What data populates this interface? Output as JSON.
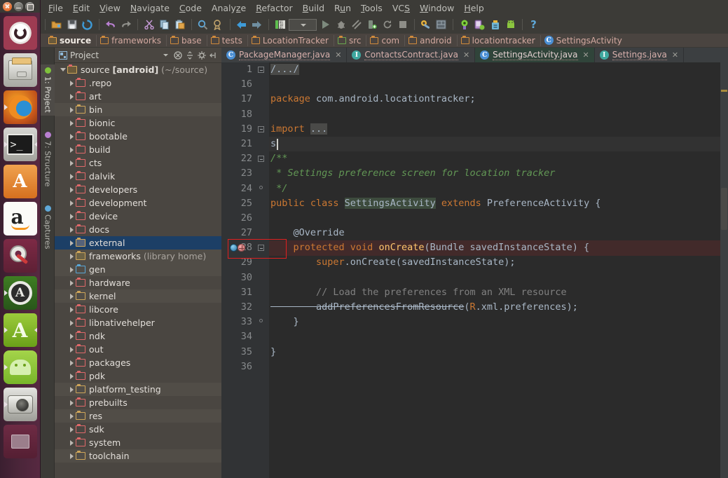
{
  "window_buttons": [
    {
      "name": "close",
      "icon": "close-icon"
    },
    {
      "name": "minimize",
      "icon": "minimize-icon"
    },
    {
      "name": "maximize",
      "icon": "maximize-icon"
    }
  ],
  "launcher": {
    "items": [
      {
        "label": "Ubuntu Dash",
        "icon": "ubuntu-dash-icon",
        "running": false
      },
      {
        "label": "Files",
        "icon": "files-icon",
        "running": false
      },
      {
        "label": "Firefox Web Browser",
        "icon": "firefox-icon",
        "running": true
      },
      {
        "label": "Terminal",
        "icon": "terminal-icon",
        "running": true
      },
      {
        "label": "Ubuntu Software Center",
        "icon": "software-center-icon",
        "running": false
      },
      {
        "label": "Amazon",
        "icon": "amazon-icon",
        "running": false
      },
      {
        "label": "System Settings",
        "icon": "system-settings-icon",
        "running": false
      },
      {
        "label": "Android Studio",
        "icon": "android-studio-icon",
        "running": true
      },
      {
        "label": "Android Virtual Device Manager",
        "icon": "avd-manager-icon",
        "running": true
      },
      {
        "label": "Android SDK Manager",
        "icon": "android-robot-icon",
        "running": true
      },
      {
        "label": "Camera",
        "icon": "camera-icon",
        "running": true
      },
      {
        "label": "Trash",
        "icon": "trash-icon",
        "running": false
      }
    ]
  },
  "menubar": {
    "items": [
      {
        "label": "File",
        "mnemonic": "F"
      },
      {
        "label": "Edit",
        "mnemonic": "E"
      },
      {
        "label": "View",
        "mnemonic": "V"
      },
      {
        "label": "Navigate",
        "mnemonic": "N"
      },
      {
        "label": "Code",
        "mnemonic": "C"
      },
      {
        "label": "Analyze",
        "mnemonic": "z"
      },
      {
        "label": "Refactor",
        "mnemonic": "R"
      },
      {
        "label": "Build",
        "mnemonic": "B"
      },
      {
        "label": "Run",
        "mnemonic": "u"
      },
      {
        "label": "Tools",
        "mnemonic": "T"
      },
      {
        "label": "VCS",
        "mnemonic": "S"
      },
      {
        "label": "Window",
        "mnemonic": "W"
      },
      {
        "label": "Help",
        "mnemonic": "H"
      }
    ]
  },
  "toolbar": {
    "buttons": [
      {
        "name": "open-project-icon",
        "title": "Open"
      },
      {
        "name": "save-all-icon",
        "title": "Save All"
      },
      {
        "name": "sync-icon",
        "title": "Synchronize"
      },
      {
        "sep": true
      },
      {
        "name": "undo-icon",
        "title": "Undo"
      },
      {
        "name": "redo-icon",
        "title": "Redo"
      },
      {
        "sep": true
      },
      {
        "name": "cut-icon",
        "title": "Cut"
      },
      {
        "name": "copy-icon",
        "title": "Copy"
      },
      {
        "name": "paste-icon",
        "title": "Paste"
      },
      {
        "sep": true
      },
      {
        "name": "find-icon",
        "title": "Find"
      },
      {
        "name": "replace-icon",
        "title": "Replace"
      },
      {
        "sep": true
      },
      {
        "name": "back-icon",
        "title": "Back"
      },
      {
        "name": "forward-icon",
        "title": "Forward"
      },
      {
        "sep": true
      },
      {
        "name": "run-config-icon",
        "title": "Run Configurations"
      },
      {
        "name": "run-config-dropdown",
        "title": "Select Run Configuration"
      },
      {
        "name": "run-icon",
        "title": "Run"
      },
      {
        "name": "debug-icon",
        "title": "Debug"
      },
      {
        "name": "coverage-icon",
        "title": "Run with Coverage"
      },
      {
        "name": "attach-debugger-icon",
        "title": "Attach debugger"
      },
      {
        "name": "rerun-icon",
        "title": "Rerun"
      },
      {
        "name": "stop-icon",
        "title": "Stop"
      },
      {
        "sep": true
      },
      {
        "name": "sdk-manager-icon",
        "title": "SDK Manager"
      },
      {
        "name": "avd-manager-icon",
        "title": "AVD Manager"
      },
      {
        "sep": true
      },
      {
        "name": "monitor-icon",
        "title": "Android Device Monitor"
      },
      {
        "name": "ddms-icon",
        "title": "Android Monitor"
      },
      {
        "name": "sync-gradle-icon",
        "title": "Sync Project with Gradle Files"
      },
      {
        "name": "android-icon",
        "title": "Android"
      },
      {
        "sep": true
      },
      {
        "name": "help-icon",
        "title": "Help"
      }
    ]
  },
  "breadcrumb": {
    "items": [
      {
        "label": "source",
        "icon": "folder-selected-icon",
        "selected": true
      },
      {
        "label": "frameworks",
        "icon": "folder-icon"
      },
      {
        "label": "base",
        "icon": "folder-icon"
      },
      {
        "label": "tests",
        "icon": "folder-icon"
      },
      {
        "label": "LocationTracker",
        "icon": "folder-icon"
      },
      {
        "label": "src",
        "icon": "folder-green-icon"
      },
      {
        "label": "com",
        "icon": "folder-icon"
      },
      {
        "label": "android",
        "icon": "folder-icon"
      },
      {
        "label": "locationtracker",
        "icon": "folder-icon"
      },
      {
        "label": "SettingsActivity",
        "icon": "class-icon"
      }
    ]
  },
  "tool_tabs": [
    {
      "label": "1: Project",
      "icon": "project-icon",
      "active": true
    },
    {
      "label": "7: Structure",
      "icon": "structure-icon",
      "active": false
    },
    {
      "label": "Captures",
      "icon": "captures-icon",
      "active": false
    }
  ],
  "project_panel": {
    "title": "Project",
    "header_icons": [
      {
        "name": "project-view-icon"
      },
      {
        "name": "view-mode-dropdown-icon"
      },
      {
        "name": "collapse-icon"
      },
      {
        "name": "expand-all-icon"
      },
      {
        "name": "settings-gear-icon"
      },
      {
        "name": "hide-panel-icon"
      }
    ],
    "root": {
      "label": "source",
      "badge": "[android]",
      "path": "(~/source)",
      "expanded": true
    },
    "items": [
      {
        "label": ".repo",
        "kind": "folder",
        "selected": false,
        "alt": false
      },
      {
        "label": "art",
        "kind": "folder",
        "selected": false,
        "alt": false
      },
      {
        "label": "bin",
        "kind": "folder-yellow",
        "selected": false,
        "alt": true
      },
      {
        "label": "bionic",
        "kind": "folder",
        "selected": false,
        "alt": false
      },
      {
        "label": "bootable",
        "kind": "folder",
        "selected": false,
        "alt": false
      },
      {
        "label": "build",
        "kind": "folder",
        "selected": false,
        "alt": false
      },
      {
        "label": "cts",
        "kind": "folder",
        "selected": false,
        "alt": false
      },
      {
        "label": "dalvik",
        "kind": "folder",
        "selected": false,
        "alt": false
      },
      {
        "label": "developers",
        "kind": "folder",
        "selected": false,
        "alt": false
      },
      {
        "label": "development",
        "kind": "folder",
        "selected": false,
        "alt": false
      },
      {
        "label": "device",
        "kind": "folder",
        "selected": false,
        "alt": false
      },
      {
        "label": "docs",
        "kind": "folder",
        "selected": false,
        "alt": false
      },
      {
        "label": "external",
        "kind": "folder-external",
        "selected": true,
        "alt": false
      },
      {
        "label": "frameworks",
        "suffix": "(library home)",
        "kind": "folder-library",
        "selected": false,
        "alt": true
      },
      {
        "label": "gen",
        "kind": "folder-blue",
        "selected": false,
        "alt": true
      },
      {
        "label": "hardware",
        "kind": "folder",
        "selected": false,
        "alt": false
      },
      {
        "label": "kernel",
        "kind": "folder-yellow",
        "selected": false,
        "alt": true
      },
      {
        "label": "libcore",
        "kind": "folder",
        "selected": false,
        "alt": false
      },
      {
        "label": "libnativehelper",
        "kind": "folder",
        "selected": false,
        "alt": false
      },
      {
        "label": "ndk",
        "kind": "folder",
        "selected": false,
        "alt": false
      },
      {
        "label": "out",
        "kind": "folder",
        "selected": false,
        "alt": false
      },
      {
        "label": "packages",
        "kind": "folder",
        "selected": false,
        "alt": false
      },
      {
        "label": "pdk",
        "kind": "folder",
        "selected": false,
        "alt": false
      },
      {
        "label": "platform_testing",
        "kind": "folder-yellow",
        "selected": false,
        "alt": true
      },
      {
        "label": "prebuilts",
        "kind": "folder",
        "selected": false,
        "alt": false
      },
      {
        "label": "res",
        "kind": "folder-yellow",
        "selected": false,
        "alt": true
      },
      {
        "label": "sdk",
        "kind": "folder",
        "selected": false,
        "alt": false
      },
      {
        "label": "system",
        "kind": "folder",
        "selected": false,
        "alt": false
      },
      {
        "label": "toolchain",
        "kind": "folder-yellow",
        "selected": false,
        "alt": true
      }
    ]
  },
  "editor_tabs": [
    {
      "label": "PackageManager.java",
      "icon": "class-icon",
      "active": false,
      "closable": true
    },
    {
      "label": "ContactsContract.java",
      "icon": "interface-icon",
      "active": false,
      "closable": true
    },
    {
      "label": "SettingsActivity.java",
      "icon": "class-icon",
      "active": true,
      "closable": true
    },
    {
      "label": "Settings.java",
      "icon": "interface-icon",
      "active": false,
      "closable": true
    }
  ],
  "editor": {
    "file": "SettingsActivity.java",
    "caret_line": 21,
    "gutter_badges": [
      {
        "line": 28,
        "icon": "override-method-icon"
      },
      {
        "line": 28,
        "icon": "breakpoint-icon"
      }
    ],
    "annotation": {
      "shape": "rectangle",
      "color": "#e02020",
      "target": "line-28-gutter-icons"
    },
    "lines": [
      {
        "num": "1",
        "fold": "minus",
        "segments": [
          {
            "t": "/.../",
            "c": "hlgrey"
          }
        ]
      },
      {
        "num": "16",
        "segments": []
      },
      {
        "num": "17",
        "segments": [
          {
            "t": "package ",
            "c": "kw"
          },
          {
            "t": "com.android.locationtracker;",
            "c": "plain"
          }
        ]
      },
      {
        "num": "18",
        "segments": []
      },
      {
        "num": "19",
        "fold": "minus",
        "segments": [
          {
            "t": "import ",
            "c": "kw"
          },
          {
            "t": "...",
            "c": "hlgrey"
          }
        ]
      },
      {
        "num": "21",
        "current": true,
        "segments": [
          {
            "t": "s",
            "c": "plain"
          }
        ]
      },
      {
        "num": "22",
        "fold": "minus",
        "segments": [
          {
            "t": "/**",
            "c": "cmt"
          }
        ]
      },
      {
        "num": "23",
        "segments": [
          {
            "t": " * Settings preference screen for location tracker",
            "c": "cmt"
          }
        ]
      },
      {
        "num": "24",
        "fold": "dot",
        "segments": [
          {
            "t": " */",
            "c": "cmt"
          }
        ]
      },
      {
        "num": "25",
        "segments": [
          {
            "t": "public class ",
            "c": "kw"
          },
          {
            "t": "SettingsActivity",
            "c": "hlg"
          },
          {
            "t": " ",
            "c": "plain"
          },
          {
            "t": "extends",
            "c": "kw"
          },
          {
            "t": " PreferenceActivity {",
            "c": "plain"
          }
        ]
      },
      {
        "num": "26",
        "segments": []
      },
      {
        "num": "27",
        "segments": [
          {
            "t": "    @Override",
            "c": "ann"
          }
        ]
      },
      {
        "num": "28",
        "fold": "minus",
        "error": true,
        "segments": [
          {
            "t": "    protected void ",
            "c": "kw"
          },
          {
            "t": "onCreate",
            "c": "mth"
          },
          {
            "t": "(Bundle savedInstanceState) {",
            "c": "plain"
          }
        ]
      },
      {
        "num": "29",
        "segments": [
          {
            "t": "        super",
            "c": "kw"
          },
          {
            "t": ".onCreate(savedInstanceState);",
            "c": "plain"
          }
        ]
      },
      {
        "num": "30",
        "segments": []
      },
      {
        "num": "31",
        "segments": [
          {
            "t": "        // Load the preferences from an XML resource",
            "c": "cmt2"
          }
        ]
      },
      {
        "num": "32",
        "segments": [
          {
            "t": "        addPreferencesFromResource",
            "c": "strike"
          },
          {
            "t": "(",
            "c": "plain"
          },
          {
            "t": "R",
            "c": "redid"
          },
          {
            "t": ".xml.preferences);",
            "c": "plain"
          }
        ]
      },
      {
        "num": "33",
        "fold": "dot",
        "segments": [
          {
            "t": "    }",
            "c": "plain"
          }
        ]
      },
      {
        "num": "34",
        "segments": []
      },
      {
        "num": "35",
        "segments": [
          {
            "t": "}",
            "c": "plain"
          }
        ]
      },
      {
        "num": "36",
        "segments": []
      }
    ]
  },
  "colors": {
    "accent": "#cc7832",
    "editor_bg": "#2b2b2b",
    "panel_bg": "#4a4641",
    "gutter_bg": "#313335",
    "selection": "#1c3f66",
    "annotation": "#e02020",
    "comment": "#629755",
    "method": "#ffc66d"
  }
}
